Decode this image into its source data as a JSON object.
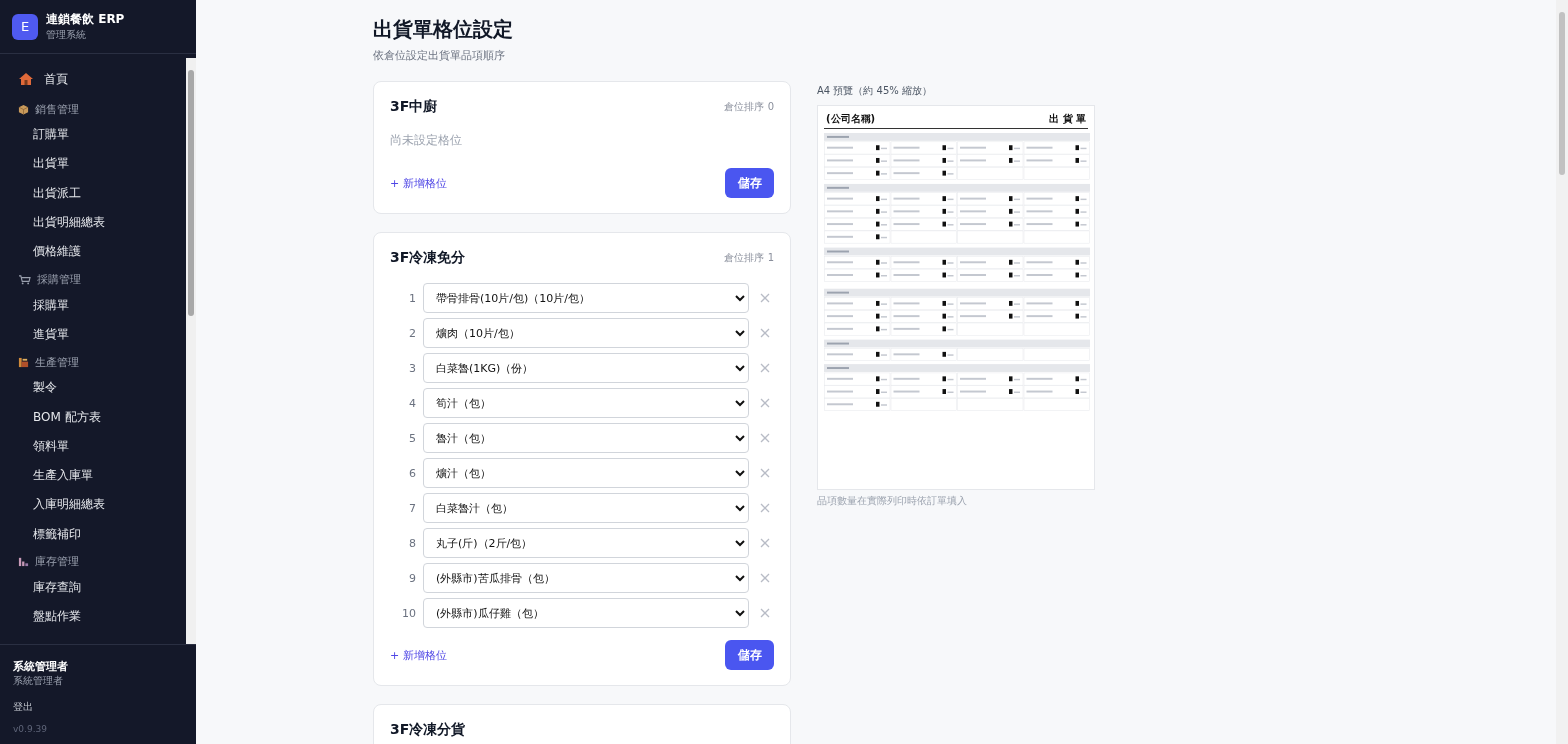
{
  "sidebar": {
    "logo_letter": "E",
    "app_name": "連鎖餐飲 ERP",
    "app_subtitle": "管理系統",
    "nav": [
      {
        "kind": "link",
        "label": "首頁"
      },
      {
        "kind": "section",
        "label": "銷售管理"
      },
      {
        "kind": "sub",
        "label": "訂購單"
      },
      {
        "kind": "sub",
        "label": "出貨單"
      },
      {
        "kind": "sub",
        "label": "出貨派工"
      },
      {
        "kind": "sub",
        "label": "出貨明細總表"
      },
      {
        "kind": "sub",
        "label": "價格維護"
      },
      {
        "kind": "section",
        "label": "採購管理"
      },
      {
        "kind": "sub",
        "label": "採購單"
      },
      {
        "kind": "sub",
        "label": "進貨單"
      },
      {
        "kind": "section",
        "label": "生產管理"
      },
      {
        "kind": "sub",
        "label": "製令"
      },
      {
        "kind": "sub",
        "label": "BOM 配方表"
      },
      {
        "kind": "sub",
        "label": "領料單"
      },
      {
        "kind": "sub",
        "label": "生產入庫單"
      },
      {
        "kind": "sub",
        "label": "入庫明細總表"
      },
      {
        "kind": "sub",
        "label": "標籤補印"
      },
      {
        "kind": "section",
        "label": "庫存管理"
      },
      {
        "kind": "sub",
        "label": "庫存查詢"
      },
      {
        "kind": "sub",
        "label": "盤點作業"
      }
    ],
    "user_name": "系統管理者",
    "user_role": "系統管理者",
    "logout": "登出",
    "version": "v0.9.39"
  },
  "page": {
    "title": "出貨單格位設定",
    "subtitle": "依倉位設定出貨單品項順序"
  },
  "warehouses": [
    {
      "name": "3F中廚",
      "order_label": "倉位排序 0",
      "empty_text": "尚未設定格位",
      "add_label": "+ 新增格位",
      "save_label": "儲存"
    },
    {
      "name": "3F冷凍免分",
      "order_label": "倉位排序 1",
      "slots": [
        {
          "number": "1",
          "value": "帶骨排骨(10片/包)（10片/包）"
        },
        {
          "number": "2",
          "value": "爌肉（10片/包）"
        },
        {
          "number": "3",
          "value": "白菜魯(1KG)（份）"
        },
        {
          "number": "4",
          "value": "筍汁（包）"
        },
        {
          "number": "5",
          "value": "魯汁（包）"
        },
        {
          "number": "6",
          "value": "爌汁（包）"
        },
        {
          "number": "7",
          "value": "白菜魯汁（包）"
        },
        {
          "number": "8",
          "value": "丸子(斤)（2斤/包）"
        },
        {
          "number": "9",
          "value": "(外縣市)苦瓜排骨（包）"
        },
        {
          "number": "10",
          "value": "(外縣市)瓜仔雞（包）"
        }
      ],
      "add_label": "+ 新增格位",
      "save_label": "儲存"
    },
    {
      "name": "3F冷凍分貨"
    }
  ],
  "preview": {
    "caption": "A4 預覽（約 45% 縮放）",
    "company": "(公司名稱)",
    "doc_title": "出 貨 單",
    "note": "品項數量在實際列印時依訂單填入"
  }
}
